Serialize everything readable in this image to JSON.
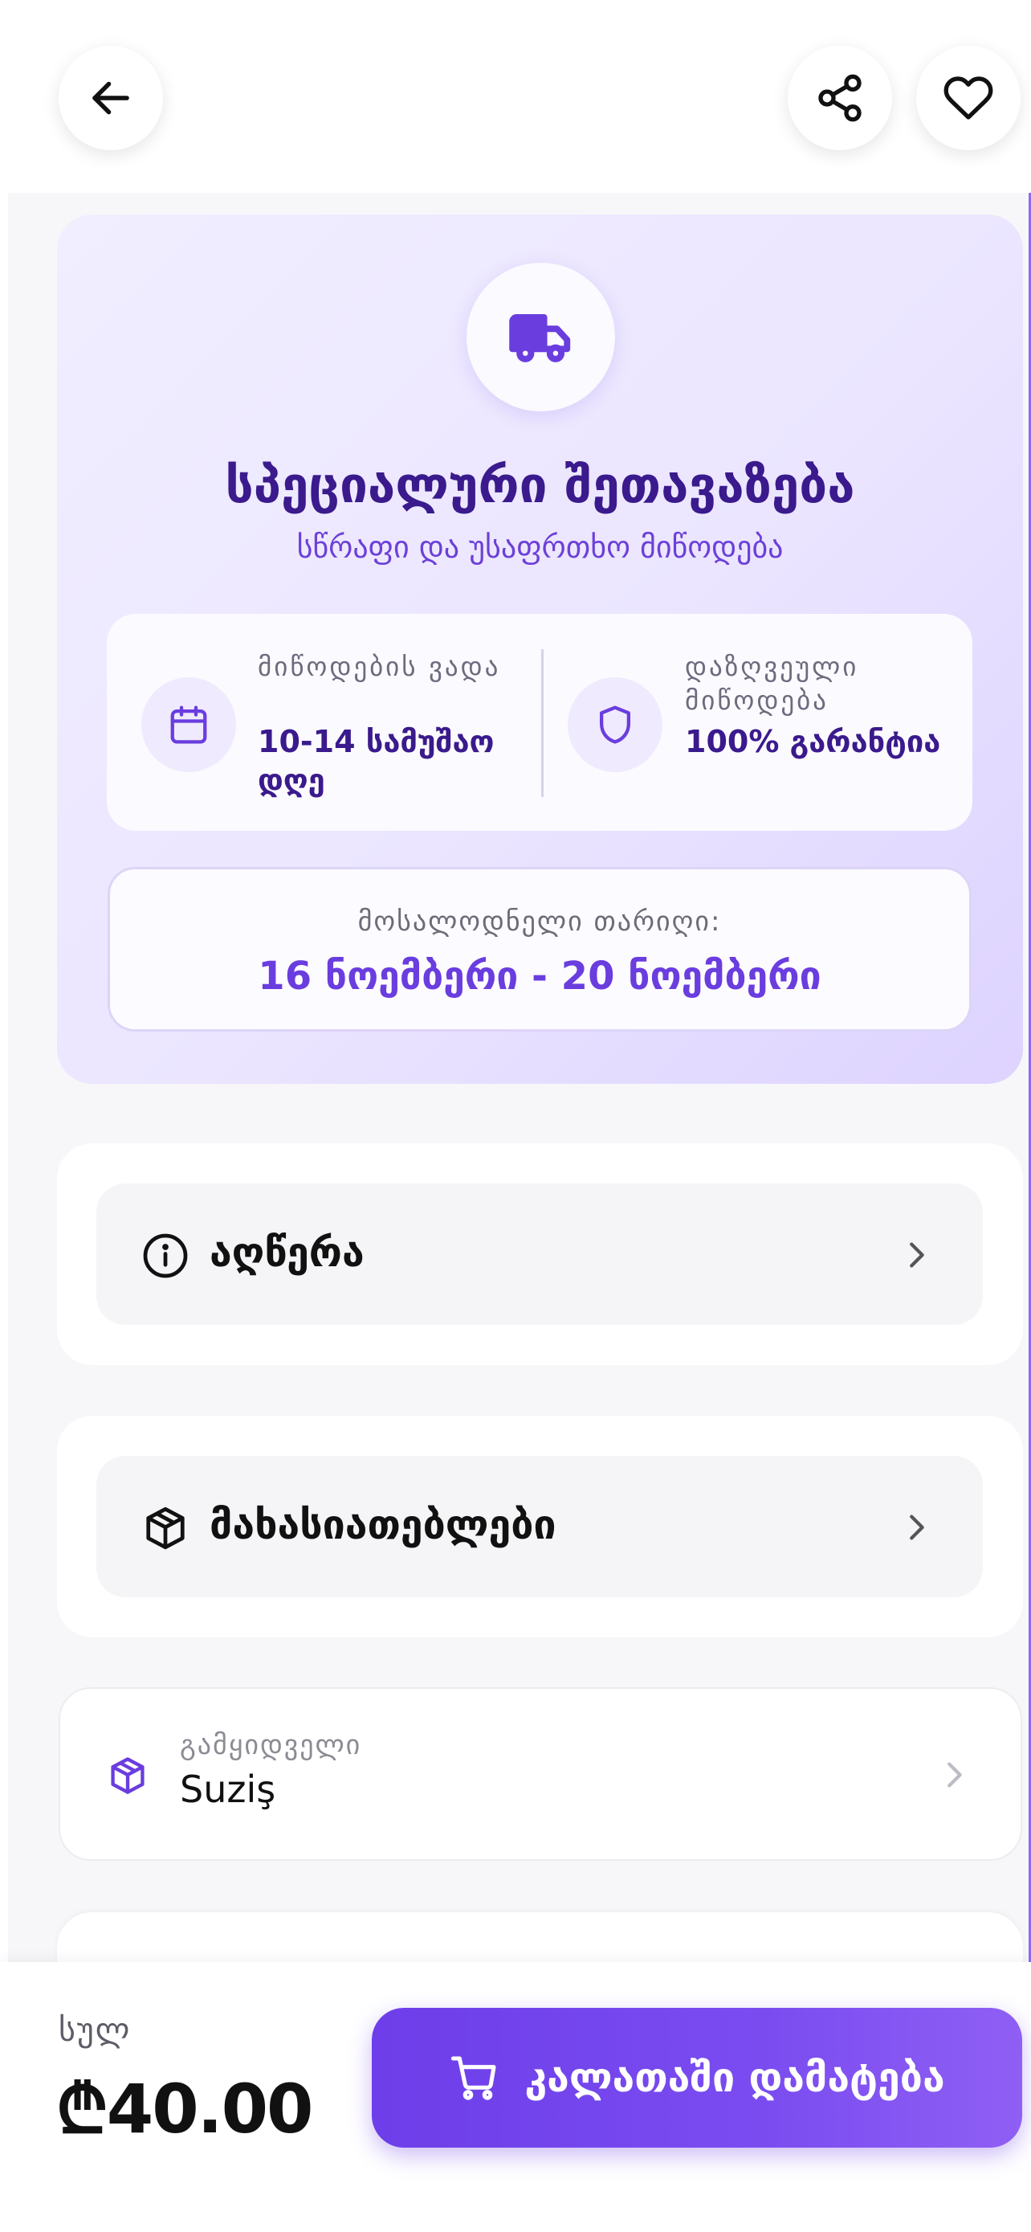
{
  "colors": {
    "accent": "#6a3ddf",
    "heading": "#3a1a8c",
    "hero_bg": "#ebe5ff",
    "page_bg": "#f7f7f9"
  },
  "header": {
    "icons": [
      "arrow-left-icon",
      "share-icon",
      "heart-icon"
    ]
  },
  "hero": {
    "icon": "truck-icon",
    "title": "სპეციალური შეთავაზება",
    "subtitle": "სწრაფი და უსაფრთხო მიწოდება",
    "delivery_time": {
      "icon": "calendar-icon",
      "label": "მიწოდების ვადა",
      "value": "10-14 სამუშაო დღე"
    },
    "guarantee": {
      "icon": "shield-icon",
      "label": "დაზღვეული მიწოდება",
      "value": "100% გარანტია"
    },
    "expected_date": {
      "label": "მოსალოდნელი თარიღი:",
      "value": "16 ნოემბერი - 20 ნოემბერი"
    }
  },
  "sections": [
    {
      "label": "აღწერა",
      "icon": "info-icon"
    },
    {
      "label": "მახასიათებლები",
      "icon": "box-icon"
    }
  ],
  "seller": {
    "icon": "package-icon",
    "label": "გამყიდველი",
    "name": "Suziş"
  },
  "footer": {
    "total_label": "სულ",
    "price": "₾40.00",
    "cart_button_label": "კალათაში დამატება",
    "cart_icon": "cart-icon"
  }
}
